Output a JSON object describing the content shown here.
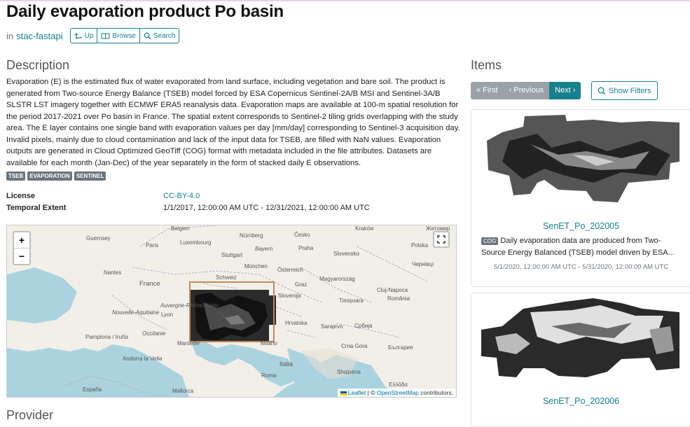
{
  "header": {
    "title": "Daily evaporation product Po basin",
    "in_label": "in",
    "catalog_link": "stac-fastapi",
    "buttons": [
      {
        "label": "Up",
        "icon": "up-arrow-icon"
      },
      {
        "label": "Browse",
        "icon": "book-icon"
      },
      {
        "label": "Search",
        "icon": "search-icon"
      }
    ]
  },
  "description": {
    "heading": "Description",
    "text": "Evaporation (E) is the estimated flux of water evaporated from land surface, including vegetation and bare soil. The product is generated from Two-source Energy Balance (TSEB) model forced by ESA Copernicus Sentinel-2A/B MSI and Sentinel-3A/B SLSTR LST imagery together with ECMWF ERA5 reanalysis data. Evaporation maps are available at 100-m spatial resolution for the period 2017-2021 over Po basin in France. The spatial extent corresponds to Sentinel-2 tiling grids overlapping with the study area. The E layer contains one single band with evaporation values per day [mm/day] corresponding to Sentinel-3 acquisition day. Invalid pixels, mainly due to cloud contamination and lack of the input data for TSEB, are filled with NaN values. Evaporation outputs are generated in Cloud Optimized GeoTiff (COG) format with metadata included in the file attributes. Datasets are available for each month (Jan-Dec) of the year separately in the form of stacked daily E observations.",
    "keywords": [
      "TSEB",
      "EVAPORATION",
      "SENTINEL"
    ]
  },
  "metadata": {
    "license_label": "License",
    "license_value": "CC-BY-4.0",
    "temporal_label": "Temporal Extent",
    "temporal_value": "1/1/2017, 12:00:00 AM UTC - 12/31/2021, 12:00:00 AM UTC"
  },
  "map": {
    "zoom_in": "+",
    "zoom_out": "−",
    "attribution_leaflet": "Leaflet",
    "attribution_sep": " | © ",
    "attribution_osm": "OpenStreetMap",
    "attribution_tail": " contributors.",
    "labels": [
      "Belgien",
      "Guernsey",
      "Nürnberg",
      "Česko",
      "Kraków",
      "Житомир",
      "Luxembourg",
      "Paris",
      "Bayern",
      "Praha",
      "Slovensko",
      "Stuttgart",
      "Polska",
      "München",
      "Nantes",
      "Österreich",
      "Чернівці",
      "France",
      "Schweiz",
      "Magyarország",
      "Graz",
      "Cluj-Napoca",
      "Slovenija",
      "Timișoara",
      "România",
      "Hrvatska",
      "Sarajevo",
      "Србија",
      "Occitanie",
      "Pamplona / Iruña",
      "Marseille",
      "Crna Gora",
      "България",
      "Italia",
      "Shqipëria",
      "Roma",
      "Andorra la Vella",
      "España",
      "Ελλάδα",
      "Nouvelle-Aquitaine",
      "Auvergne-Rhône-Alpes",
      "Milano",
      "Lyon",
      "Mallorca"
    ],
    "accent": "#c08a5b"
  },
  "items": {
    "heading": "Items",
    "pager": {
      "first": "« First",
      "previous": "‹ Previous",
      "next": "Next ›"
    },
    "show_filters": "Show Filters",
    "cards": [
      {
        "title": "SenET_Po_202005",
        "badge": "COG",
        "desc": "Daily evaporation data are produced from Two-Source Energy Balanced (TSEB) model driven by ESA...",
        "date": "5/1/2020, 12:00:00 AM UTC - 5/31/2020, 12:00:00 AM UTC"
      },
      {
        "title": "SenET_Po_202006"
      }
    ]
  },
  "next_heading": "Provider"
}
